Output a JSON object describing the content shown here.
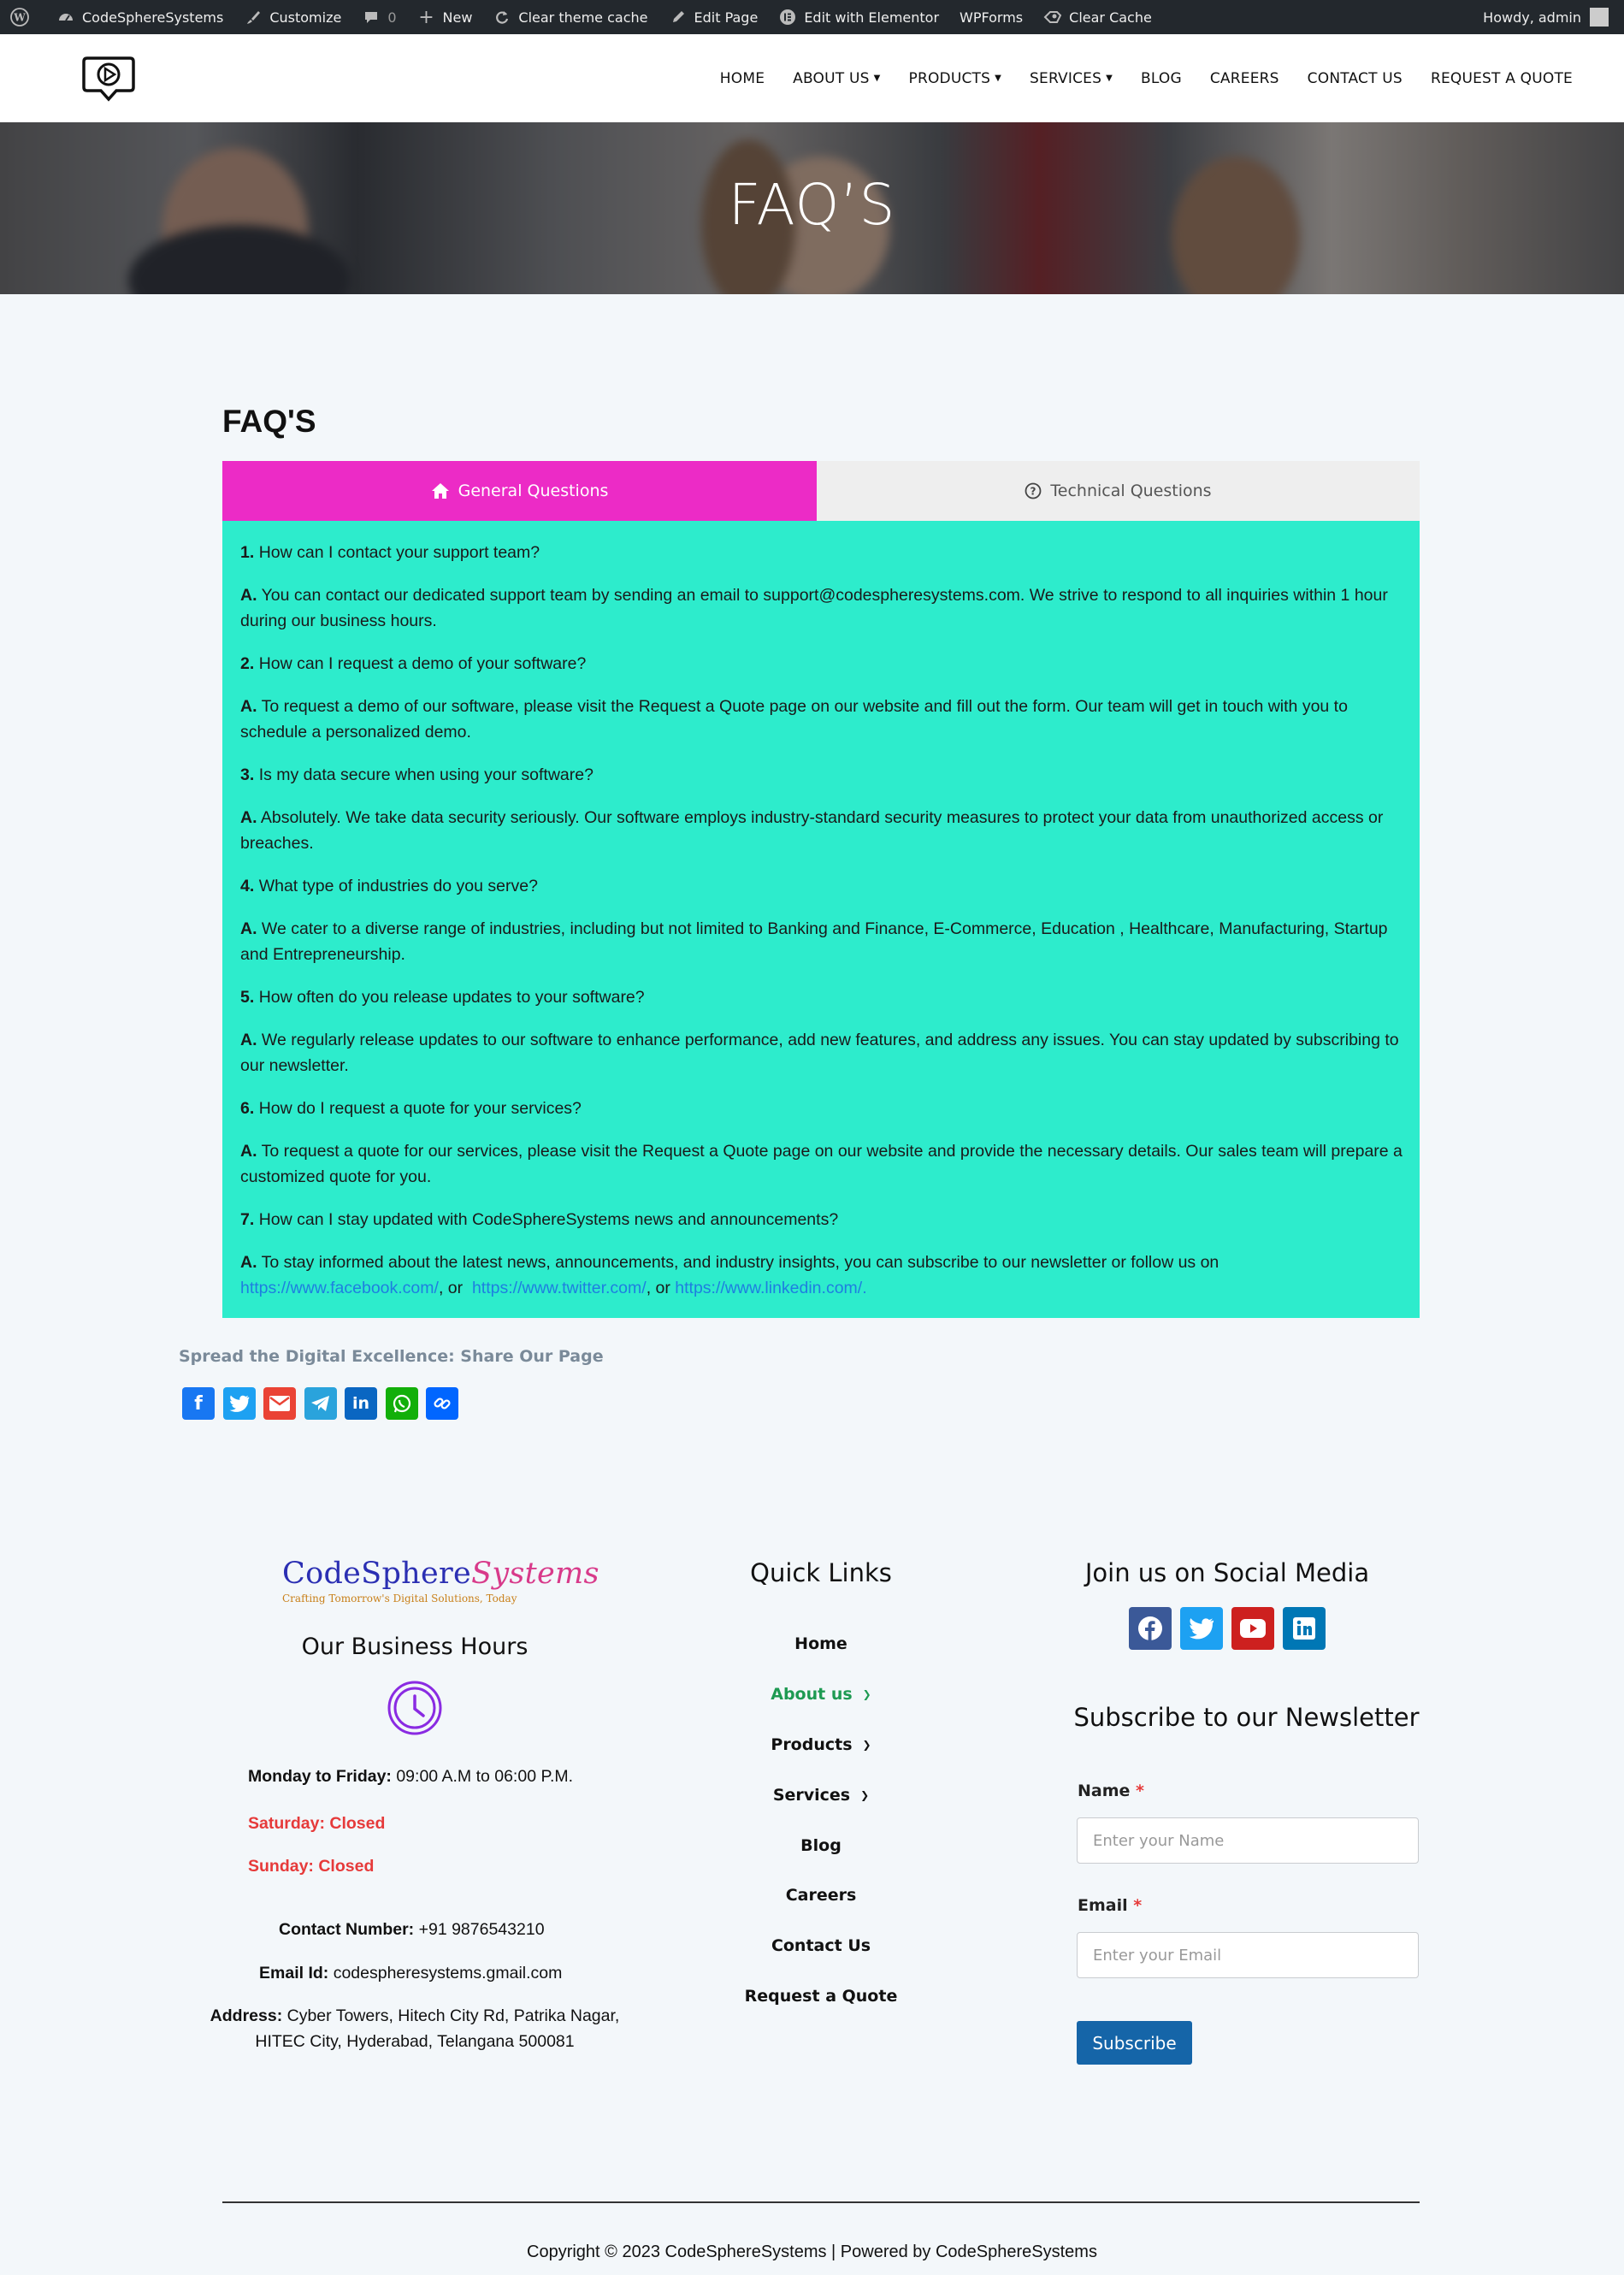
{
  "admin_bar": {
    "site_name": "CodeSphereSystems",
    "customize": "Customize",
    "comments_count": "0",
    "new": "New",
    "clear_theme_cache": "Clear theme cache",
    "edit_page": "Edit Page",
    "edit_elementor": "Edit with Elementor",
    "wpforms": "WPForms",
    "clear_cache": "Clear Cache",
    "howdy": "Howdy, admin"
  },
  "nav": {
    "items": [
      "HOME",
      "ABOUT US",
      "PRODUCTS",
      "SERVICES",
      "BLOG",
      "CAREERS",
      "CONTACT US",
      "REQUEST A QUOTE"
    ]
  },
  "hero": {
    "title": "FAQ’S"
  },
  "faq": {
    "heading": "FAQ'S",
    "tabs": [
      "General Questions",
      "Technical Questions"
    ],
    "items": [
      {
        "num": "1.",
        "q": "How can I contact your support team?",
        "a": "You can contact our dedicated support team by sending an email to support@codespheresystems.com. We strive to respond to all inquiries within 1 hour during our business hours."
      },
      {
        "num": "2.",
        "q": "How can I request a demo of your software?",
        "a": "To request a demo of our software, please visit the Request a Quote page on our website and fill out the form. Our team will get in touch with you to schedule a personalized demo."
      },
      {
        "num": "3.",
        "q": "Is my data secure when using your software?",
        "a": "Absolutely. We take data security seriously. Our software employs industry-standard security measures to protect your data from unauthorized access or breaches."
      },
      {
        "num": "4.",
        "q": "What type of industries do you serve?",
        "a": "We cater to a diverse range of industries, including but not limited to Banking and Finance, E-Commerce, Education , Healthcare, Manufacturing, Startup and Entrepreneurship."
      },
      {
        "num": "5.",
        "q": "How often do you release updates to your software?",
        "a": "We regularly release updates to our software to enhance performance, add new features, and address any issues. You can stay updated by subscribing to our newsletter."
      },
      {
        "num": "6.",
        "q": "How do I request a quote for your services?",
        "a": "To request a quote for our services, please visit the Request a Quote page on our website and provide the necessary details. Our sales team will prepare a customized quote for you."
      },
      {
        "num": "7.",
        "q": "How can I stay updated with CodeSphereSystems news and announcements?",
        "a": "To stay informed about the latest news, announcements, and industry insights, you can subscribe to our newsletter or follow us on"
      }
    ],
    "answer_prefix": "A.",
    "links": [
      "https://www.facebook.com/",
      "https://www.twitter.com/",
      "https://www.linkedin.com/."
    ],
    "link_sep1": ", or  ",
    "link_sep2": ", or "
  },
  "share": {
    "title": "Spread the Digital Excellence: Share Our Page",
    "icons": [
      {
        "name": "facebook-share-icon",
        "color": "#1877f2",
        "glyph": "f"
      },
      {
        "name": "twitter-share-icon",
        "color": "#1da1f2",
        "glyph": "t"
      },
      {
        "name": "gmail-share-icon",
        "color": "#ea4335",
        "glyph": "M"
      },
      {
        "name": "telegram-share-icon",
        "color": "#2aa3dc",
        "glyph": "➤"
      },
      {
        "name": "linkedin-share-icon",
        "color": "#0a66c2",
        "glyph": "in"
      },
      {
        "name": "whatsapp-share-icon",
        "color": "#12af0a",
        "glyph": "✆"
      },
      {
        "name": "copy-link-share-icon",
        "color": "#0166ff",
        "glyph": "⛓"
      }
    ]
  },
  "footer": {
    "brand_part1": "CodeSphere",
    "brand_part2": "Systems",
    "brand_tagline": "Crafting Tomorrow's Digital Solutions, Today",
    "hours_title": "Our Business Hours",
    "weekday_label": "Monday to Friday:",
    "weekday_hours": " 09:00 A.M to 06:00 P.M.",
    "saturday": "Saturday: Closed",
    "sunday": "Sunday: Closed",
    "contact_label": "Contact Number:",
    "contact_value": " +91 9876543210",
    "email_label": "Email Id:",
    "email_value": " codespheresystems.gmail.com",
    "address_label": "Address:",
    "address_value": " Cyber Towers, Hitech City Rd, Patrika Nagar, HITEC City, Hyderabad, Telangana 500081",
    "quick_links_title": "Quick Links",
    "quick_links": [
      "Home",
      "About us",
      "Products",
      "Services",
      "Blog",
      "Careers",
      "Contact Us",
      "Request a Quote"
    ],
    "social_title": "Join us on Social Media",
    "newsletter_title": "Subscribe to our Newsletter",
    "name_label": "Name",
    "name_placeholder": "Enter your Name",
    "email_field_label": "Email",
    "email_placeholder": "Enter your Email",
    "required_mark": "*",
    "subscribe_button": "Subscribe",
    "copyright": "Copyright © 2023 CodeSphereSystems | Powered by CodeSphereSystems"
  },
  "colors": {
    "tab_active": "#ec2bc6",
    "panel": "#2deccc",
    "link": "#1e7fe0",
    "closed": "#e63a3a",
    "active_link": "#1e9a52",
    "subscribe": "#1565a8"
  }
}
